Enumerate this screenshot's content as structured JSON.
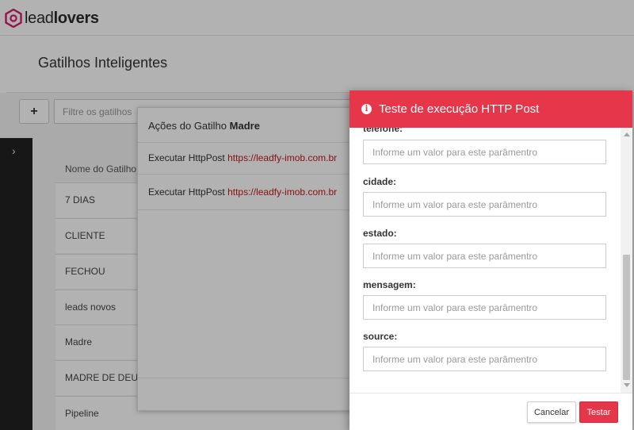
{
  "brand": {
    "logo_light": "lead",
    "logo_bold": "lovers",
    "accent_color": "#e6364a",
    "link_color": "#c21a1a"
  },
  "page": {
    "title": "Gatilhos Inteligentes"
  },
  "toolbar": {
    "add_label": "+",
    "filter_placeholder": "Filtre os gatilhos"
  },
  "table": {
    "header": "Nome do Gatilho",
    "rows": [
      "7 DIAS",
      "CLIENTE",
      "FECHOU",
      "leads novos",
      "Madre",
      "MADRE DE DEUS",
      "Pipeline"
    ]
  },
  "actions_panel": {
    "title_prefix": "Ações do Gatilho",
    "title_name": "Madre",
    "actions": [
      {
        "label": "Executar HttpPost",
        "url": "https://leadfy-imob.com.br"
      },
      {
        "label": "Executar HttpPost",
        "url": "https://leadfy-imob.com.br"
      }
    ]
  },
  "modal": {
    "title": "Teste de execução HTTP Post",
    "fields": [
      {
        "label": "telefone:",
        "placeholder": "Informe um valor para este parâmentro"
      },
      {
        "label": "cidade:",
        "placeholder": "Informe um valor para este parâmentro"
      },
      {
        "label": "estado:",
        "placeholder": "Informe um valor para este parâmentro"
      },
      {
        "label": "mensagem:",
        "placeholder": "Informe um valor para este parâmentro"
      },
      {
        "label": "source:",
        "placeholder": "Informe um valor para este parâmentro"
      }
    ],
    "cancel_label": "Cancelar",
    "test_label": "Testar"
  }
}
